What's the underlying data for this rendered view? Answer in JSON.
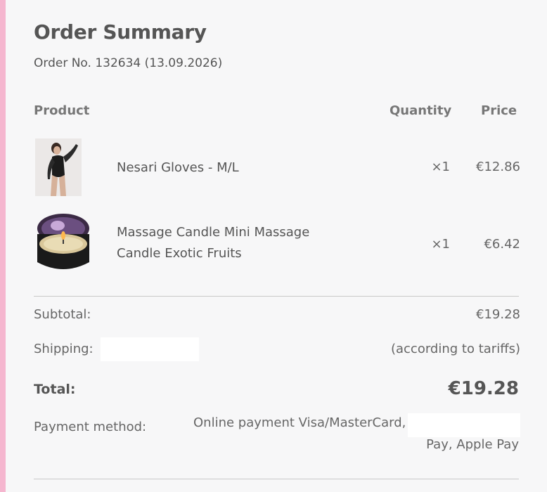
{
  "title": "Order Summary",
  "order_line": "Order No. 132634 (13.09.2026)",
  "columns": {
    "product": "Product",
    "quantity": "Quantity",
    "price": "Price"
  },
  "items": [
    {
      "name_line1": "Nesari Gloves - M/L",
      "name_line2": "",
      "quantity": "×1",
      "price": "€12.86"
    },
    {
      "name_line1": "Massage Candle Mini Massage",
      "name_line2": "Candle Exotic Fruits",
      "quantity": "×1",
      "price": "€6.42"
    }
  ],
  "summary": {
    "subtotal_label": "Subtotal:",
    "subtotal_value": "€19.28",
    "shipping_label": "Shipping:",
    "shipping_value": "(according to tariffs)",
    "total_label": "Total:",
    "total_value": "€19.28",
    "payment_label": "Payment method:",
    "payment_line1": "Online payment Visa/MasterCard,",
    "payment_line2": "Pay, Apple Pay"
  },
  "colors": {
    "accent": "#f5b6cf",
    "background": "#f7f7f8"
  }
}
